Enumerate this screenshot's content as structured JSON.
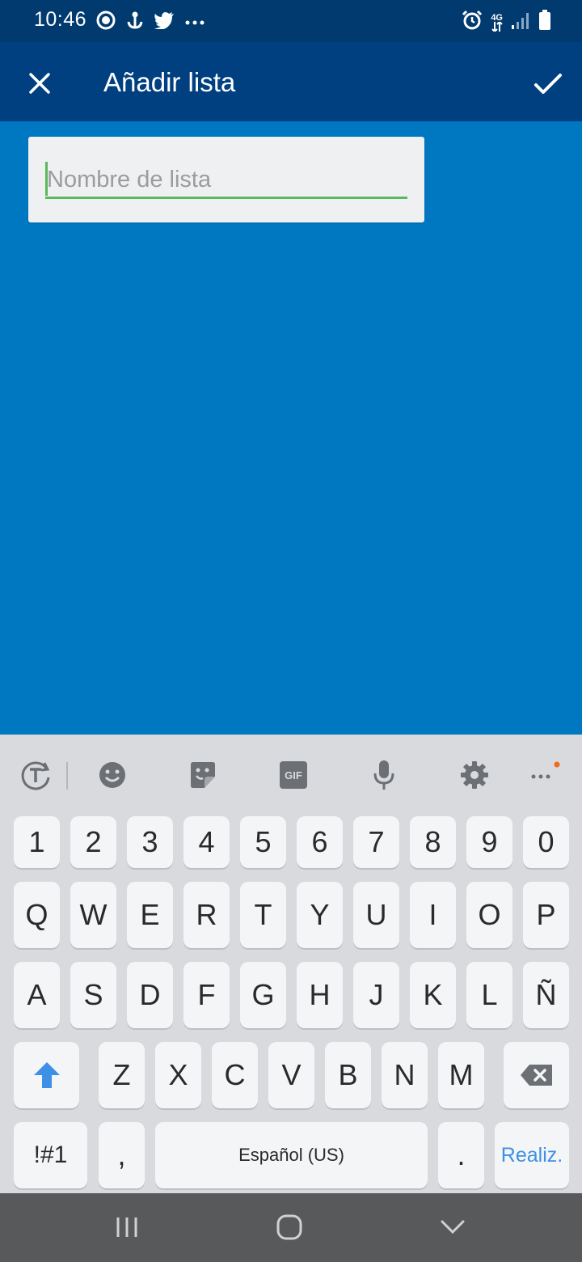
{
  "status_bar": {
    "time": "10:46",
    "left_icons": [
      "settings-gear-icon",
      "anchor-icon",
      "twitter-icon",
      "more-dots-icon"
    ],
    "right_icons": [
      "alarm-icon",
      "4g-icon",
      "signal-icon",
      "battery-icon"
    ],
    "network_label": "4G"
  },
  "app_bar": {
    "title": "Añadir lista",
    "close_icon": "close-icon",
    "confirm_icon": "check-icon"
  },
  "form": {
    "list_name_value": "",
    "list_name_placeholder": "Nombre de lista"
  },
  "keyboard": {
    "toolbar": [
      "text-mode-icon",
      "emoji-icon",
      "sticker-icon",
      "gif-icon",
      "microphone-icon",
      "settings-icon",
      "more-icon"
    ],
    "gif_label": "GIF",
    "rows": {
      "numbers": [
        "1",
        "2",
        "3",
        "4",
        "5",
        "6",
        "7",
        "8",
        "9",
        "0"
      ],
      "row1": [
        "Q",
        "W",
        "E",
        "R",
        "T",
        "Y",
        "U",
        "I",
        "O",
        "P"
      ],
      "row2": [
        "A",
        "S",
        "D",
        "F",
        "G",
        "H",
        "J",
        "K",
        "L",
        "Ñ"
      ],
      "row3": [
        "Z",
        "X",
        "C",
        "V",
        "B",
        "N",
        "M"
      ]
    },
    "symbols_label": "!#1",
    "comma_label": ",",
    "space_label": "Español (US)",
    "period_label": ".",
    "done_label": "Realiz."
  },
  "nav_bar": {
    "recents_icon": "recents-icon",
    "home_icon": "home-icon",
    "back_icon": "back-chevron-icon"
  },
  "colors": {
    "status_bar": "#003a6f",
    "app_bar": "#003f80",
    "content_bg": "#0078c1",
    "input_underline": "#5cb85c",
    "keyboard_bg": "#d8dadd",
    "nav_bar": "#58595b",
    "done_text": "#3e8fe6"
  }
}
